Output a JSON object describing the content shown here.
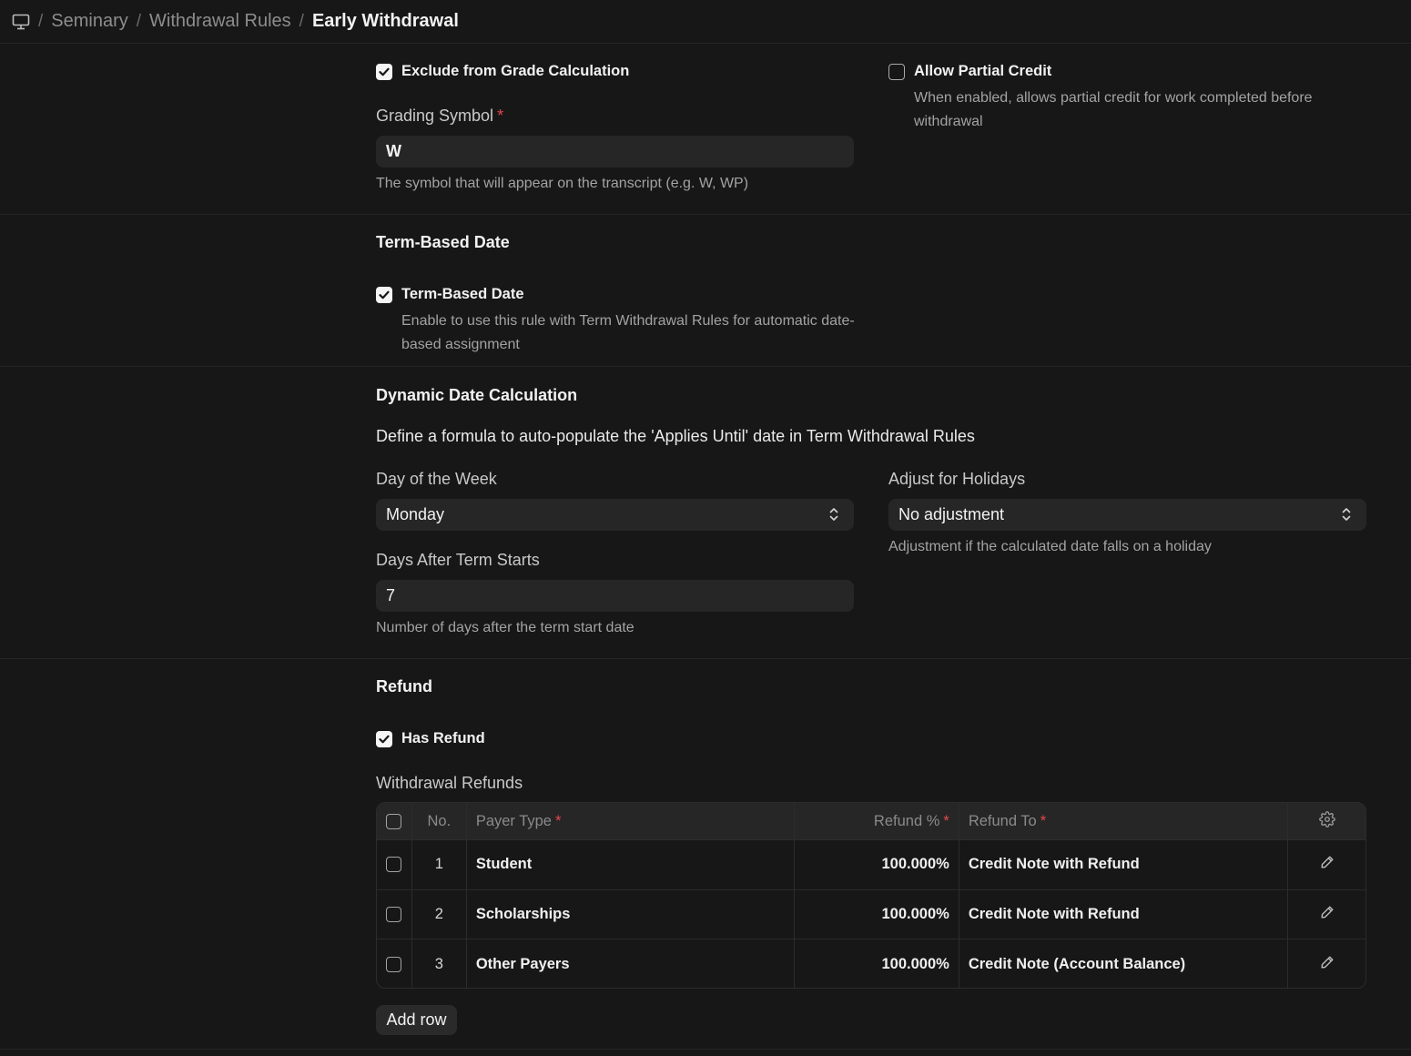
{
  "breadcrumb": {
    "icon": "desktop-icon",
    "items": [
      "Seminary",
      "Withdrawal Rules",
      "Early Withdrawal"
    ]
  },
  "grading": {
    "exclude_checked": true,
    "exclude_label": "Exclude from Grade Calculation",
    "partial_checked": false,
    "partial_label": "Allow Partial Credit",
    "partial_desc": "When enabled, allows partial credit for work completed before withdrawal",
    "symbol_label": "Grading Symbol",
    "symbol_value": "W",
    "symbol_desc": "The symbol that will appear on the transcript (e.g. W, WP)"
  },
  "term_based": {
    "section_title": "Term-Based Date",
    "checked": true,
    "label": "Term-Based Date",
    "desc": "Enable to use this rule with Term Withdrawal Rules for automatic date-based assignment"
  },
  "dynamic": {
    "section_title": "Dynamic Date Calculation",
    "intro": "Define a formula to auto-populate the 'Applies Until' date in Term Withdrawal Rules",
    "day_label": "Day of the Week",
    "day_value": "Monday",
    "holiday_label": "Adjust for Holidays",
    "holiday_value": "No adjustment",
    "holiday_desc": "Adjustment if the calculated date falls on a holiday",
    "days_label": "Days After Term Starts",
    "days_value": "7",
    "days_desc": "Number of days after the term start date"
  },
  "refund": {
    "section_title": "Refund",
    "has_refund_checked": true,
    "has_refund_label": "Has Refund",
    "table_label": "Withdrawal Refunds",
    "columns": {
      "no": "No.",
      "payer": "Payer Type",
      "pct": "Refund %",
      "to": "Refund To"
    },
    "rows": [
      {
        "no": "1",
        "payer": "Student",
        "pct": "100.000%",
        "to": "Credit Note with Refund"
      },
      {
        "no": "2",
        "payer": "Scholarships",
        "pct": "100.000%",
        "to": "Credit Note with Refund"
      },
      {
        "no": "3",
        "payer": "Other Payers",
        "pct": "100.000%",
        "to": "Credit Note (Account Balance)"
      }
    ],
    "add_row_label": "Add row"
  },
  "colors": {
    "background": "#171717",
    "input_bg": "#262626",
    "required": "#e5484d"
  }
}
